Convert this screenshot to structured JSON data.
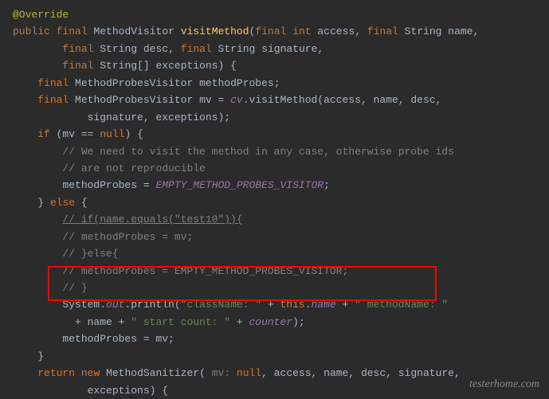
{
  "code": {
    "l1_annotation": "@Override",
    "l2_public": "public",
    "l2_final": "final",
    "l2_type": "MethodVisitor",
    "l2_method": "visitMethod",
    "l2_paren_open": "(",
    "l2_final2": "final",
    "l2_int": "int",
    "l2_access": "access",
    "l2_comma": ",",
    "l2_final3": "final",
    "l2_string": "String",
    "l2_name": "name",
    "l2_comma2": ",",
    "l3_final": "final",
    "l3_string": "String",
    "l3_desc": "desc",
    "l3_comma": ",",
    "l3_final2": "final",
    "l3_string2": "String",
    "l3_sig": "signature",
    "l3_comma2": ",",
    "l4_final": "final",
    "l4_string": "String",
    "l4_brackets": "[]",
    "l4_exc": "exceptions",
    "l4_close": ") {",
    "l5_final": "final",
    "l5_type": "MethodProbesVisitor",
    "l5_var": "methodProbes",
    "l5_semi": ";",
    "l6_final": "final",
    "l6_type": "MethodProbesVisitor",
    "l6_var": "mv",
    "l6_eq": " = ",
    "l6_cv": "cv",
    "l6_dot": ".visitMethod(access, name, desc,",
    "l7_text": "signature, exceptions);",
    "l8_if": "if",
    "l8_cond": " (mv == ",
    "l8_null": "null",
    "l8_close": ") {",
    "l9_comment": "// We need to visit the method in any case, otherwise probe ids",
    "l10_comment": "// are not reproducible",
    "l11_var": "methodProbes = ",
    "l11_const": "EMPTY_METHOD_PROBES_VISITOR",
    "l11_semi": ";",
    "l12_else_close": "}",
    "l12_else": "else",
    "l12_brace": "{",
    "l13_comment": "// if(name.equals(\"test10\")){",
    "l14_comment": "// methodProbes = mv;",
    "l15_comment": "// }else{",
    "l16_comment": "// methodProbes = EMPTY_METHOD_PROBES_VISITOR;",
    "l17_comment": "// }",
    "l18_system": "System.",
    "l18_out": "out",
    "l18_println": ".println(",
    "l18_str1": "\"className: \"",
    "l18_plus": " + ",
    "l18_this": "this",
    "l18_dotname": ".",
    "l18_name": "name",
    "l18_plus2": " + ",
    "l18_str2": "\" methodName: \"",
    "l19_plus": "+ name + ",
    "l19_str": "\" start count: \"",
    "l19_plus2": " + ",
    "l19_counter": "counter",
    "l19_close": ");",
    "l20_text": "methodProbes = mv;",
    "l21_brace": "}",
    "l22_return": "return",
    "l22_new": "new",
    "l22_type": "MethodSanitizer(",
    "l22_hint": " mv: ",
    "l22_null": "null",
    "l22_rest": ", access, name, desc, signature,",
    "l23_text": "exceptions) {"
  },
  "watermark": "testerhome.com"
}
